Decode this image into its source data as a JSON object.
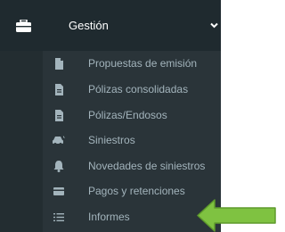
{
  "menu": {
    "section_label": "Gestión",
    "items": [
      {
        "label": "Propuestas de emisión",
        "icon": "document-icon"
      },
      {
        "label": "Pólizas consolidadas",
        "icon": "document-lines-icon"
      },
      {
        "label": "Pólizas/Endosos",
        "icon": "document-lines-icon"
      },
      {
        "label": "Siniestros",
        "icon": "car-crash-icon"
      },
      {
        "label": "Novedades de siniestros",
        "icon": "bell-icon"
      },
      {
        "label": "Pagos y retenciones",
        "icon": "card-icon"
      },
      {
        "label": "Informes",
        "icon": "list-icon"
      }
    ]
  },
  "colors": {
    "sidebar_bg": "#2a3439",
    "header_bg": "#1f2a2f",
    "item_text": "#a3b4bc",
    "arrow": "#7fc241"
  }
}
